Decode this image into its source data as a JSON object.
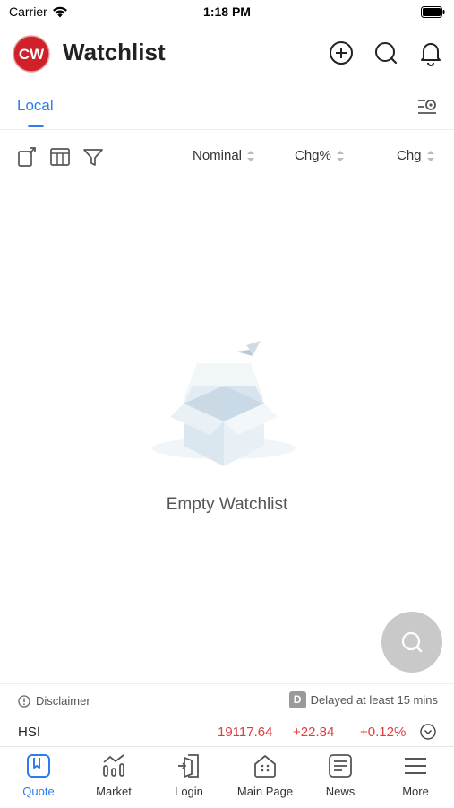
{
  "status_bar": {
    "carrier": "Carrier",
    "time": "1:18 PM"
  },
  "header": {
    "logo_text": "CW",
    "title": "Watchlist",
    "icons": [
      "add-icon",
      "search-icon",
      "bell-icon"
    ]
  },
  "tabs": {
    "active_label": "Local",
    "settings_icon": "list-settings-icon"
  },
  "toolbar": {
    "icons": [
      "export-icon",
      "columns-icon",
      "filter-icon"
    ],
    "columns": [
      "Nominal",
      "Chg%",
      "Chg"
    ]
  },
  "empty_state": {
    "message": "Empty Watchlist"
  },
  "fab": {
    "icon": "search-icon"
  },
  "disclaimer": {
    "label": "Disclaimer",
    "delay_badge": "D",
    "delay_text": "Delayed at least 15 mins"
  },
  "index_ticker": {
    "name": "HSI",
    "value": "19117.64",
    "change": "+22.84",
    "change_pct": "+0.12%"
  },
  "bottom_nav": [
    {
      "label": "Quote",
      "icon": "quote-icon",
      "active": true
    },
    {
      "label": "Market",
      "icon": "market-icon",
      "active": false
    },
    {
      "label": "Login",
      "icon": "login-icon",
      "active": false
    },
    {
      "label": "Main Page",
      "icon": "home-icon",
      "active": false
    },
    {
      "label": "News",
      "icon": "news-icon",
      "active": false
    },
    {
      "label": "More",
      "icon": "menu-icon",
      "active": false
    }
  ],
  "colors": {
    "accent": "#2d7cf0",
    "up": "#e03c3c",
    "brand_red": "#d0202a"
  }
}
